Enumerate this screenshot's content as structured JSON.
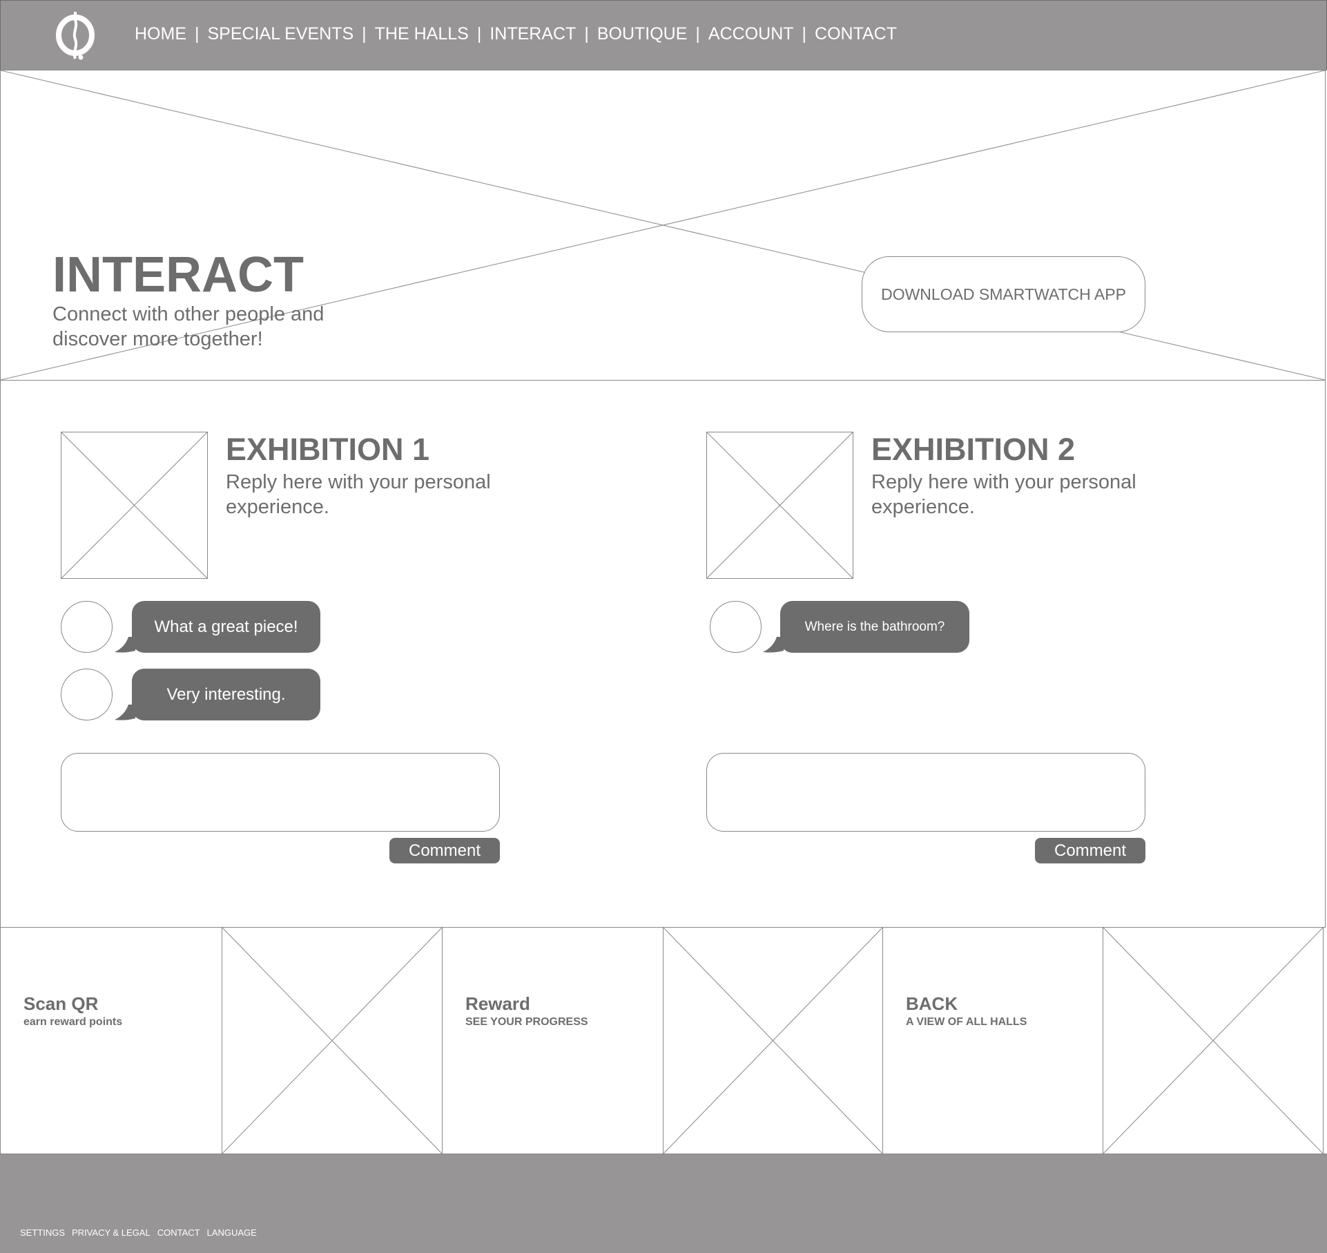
{
  "header": {
    "logo": "museum-logo-icon",
    "nav": [
      "HOME",
      "SPECIAL EVENTS",
      "THE HALLS",
      "INTERACT",
      "BOUTIQUE",
      "ACCOUNT",
      "CONTACT"
    ],
    "separator": "|"
  },
  "hero": {
    "title": "INTERACT",
    "subtitle": "Connect with other people and discover more together!",
    "download_button": "DOWNLOAD SMARTWATCH APP"
  },
  "exhibitions": [
    {
      "title": "EXHIBITION 1",
      "subtitle": "Reply here with your personal experience.",
      "comments": [
        "What a great piece!",
        "Very interesting."
      ],
      "comment_input": "",
      "comment_button": "Comment"
    },
    {
      "title": "EXHIBITION 2",
      "subtitle": "Reply here with your personal experience.",
      "comments": [
        "Where is the bathroom?"
      ],
      "comment_input": "",
      "comment_button": "Comment"
    }
  ],
  "tiles": [
    {
      "title": "Scan QR",
      "subtitle": "earn reward points"
    },
    {
      "title": "Reward",
      "subtitle": "SEE YOUR PROGRESS"
    },
    {
      "title": "BACK",
      "subtitle": "A VIEW OF ALL HALLS"
    }
  ],
  "footer": {
    "links": [
      "SETTINGS",
      "PRIVACY & LEGAL",
      "CONTACT",
      "LANGUAGE"
    ]
  },
  "colors": {
    "header_bg": "#979596",
    "text": "#6d6d6d",
    "bubble": "#6d6d6d"
  }
}
